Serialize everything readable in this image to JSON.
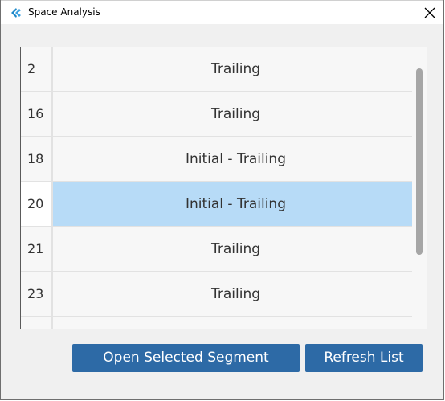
{
  "window": {
    "title": "Space Analysis",
    "icon": "app-icon",
    "close_icon": "close-icon"
  },
  "list": {
    "rows": [
      {
        "number": "2",
        "segment": "Trailing",
        "selected": false
      },
      {
        "number": "16",
        "segment": "Trailing",
        "selected": false
      },
      {
        "number": "18",
        "segment": "Initial - Trailing",
        "selected": false
      },
      {
        "number": "20",
        "segment": "Initial - Trailing",
        "selected": true
      },
      {
        "number": "21",
        "segment": "Trailing",
        "selected": false
      },
      {
        "number": "23",
        "segment": "Trailing",
        "selected": false
      },
      {
        "number": "",
        "segment": "",
        "selected": false
      }
    ]
  },
  "buttons": {
    "open_label": "Open Selected Segment",
    "refresh_label": "Refresh List"
  },
  "colors": {
    "selection": "#b7dbf7",
    "button": "#2d6aa6",
    "accent_icon": "#1e88c8"
  }
}
